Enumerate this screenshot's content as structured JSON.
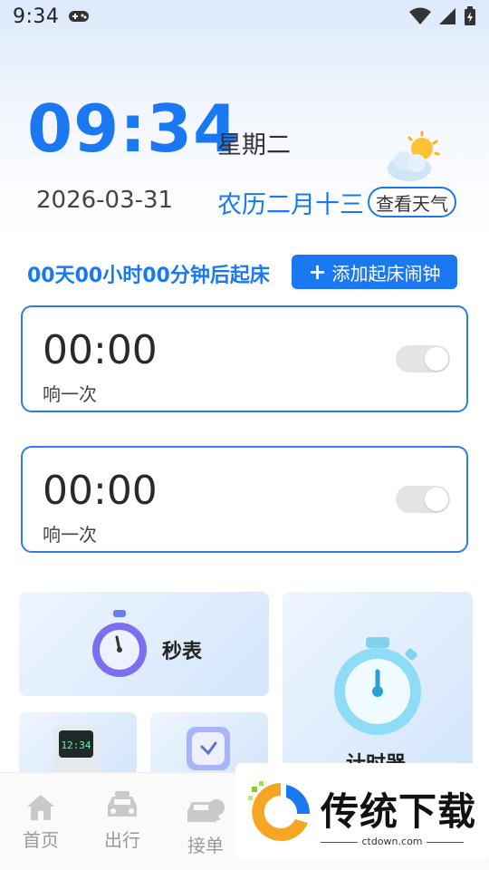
{
  "status_bar": {
    "time": "9:34"
  },
  "clock": {
    "time": "09:34",
    "weekday": "星期二",
    "date": "2026-03-31",
    "lunar": "农历二月十三",
    "weather_button": "查看天气"
  },
  "countdown": {
    "text": "00天00小时00分钟后起床",
    "add_button": "添加起床闹钟"
  },
  "alarms": [
    {
      "time": "00:00",
      "repeat": "响一次",
      "enabled": false
    },
    {
      "time": "00:00",
      "repeat": "响一次",
      "enabled": false
    }
  ],
  "tools": {
    "stopwatch_label": "秒表",
    "timer_label": "计时器"
  },
  "nav": {
    "items": [
      {
        "label": "首页",
        "icon": "home-icon"
      },
      {
        "label": "出行",
        "icon": "car-icon"
      },
      {
        "label": "接单",
        "icon": "order-car-icon"
      }
    ]
  },
  "watermark": {
    "title": "传统下载",
    "url": "ctdown.com"
  },
  "colors": {
    "accent": "#1a78f2",
    "toggle_off": "#e4e4e4"
  }
}
